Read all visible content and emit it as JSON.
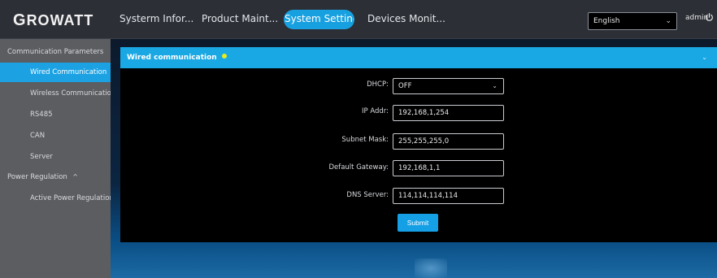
{
  "brand": {
    "logo_first": "G",
    "logo_rest": "ROWATT"
  },
  "nav": {
    "items": [
      "Systerm Infor...",
      "Product Maint...",
      "System Settings",
      "Devices Monit..."
    ],
    "active_index": 2
  },
  "header": {
    "language": "English",
    "user": "admin"
  },
  "sidebar": {
    "groups": [
      {
        "label": "Communication Parameters",
        "caret": "^"
      },
      {
        "label": "Power Regulation",
        "caret": "^"
      }
    ],
    "items": [
      "Wired Communication",
      "Wireless Communication",
      "RS485",
      "CAN",
      "Server",
      "Active Power Regulation"
    ],
    "active_item": "Wired Communication"
  },
  "panel": {
    "title": "Wired communication",
    "status_color": "#e8ec1a",
    "fields": [
      {
        "label": "DHCP:",
        "value": "OFF",
        "type": "select"
      },
      {
        "label": "IP Addr:",
        "value": "192,168,1,254",
        "type": "input"
      },
      {
        "label": "Subnet Mask:",
        "value": "255,255,255,0",
        "type": "input"
      },
      {
        "label": "Default Gateway:",
        "value": "192,168,1,1",
        "type": "input"
      },
      {
        "label": "DNS Server:",
        "value": "114,114,114,114",
        "type": "input"
      }
    ],
    "submit_label": "Submit"
  },
  "colors": {
    "accent": "#1aa8e4",
    "sidebar": "#5b5d61",
    "topbar": "#2c2f36"
  },
  "icons": {
    "chevron": "chevron-down-icon",
    "power": "power-icon"
  }
}
